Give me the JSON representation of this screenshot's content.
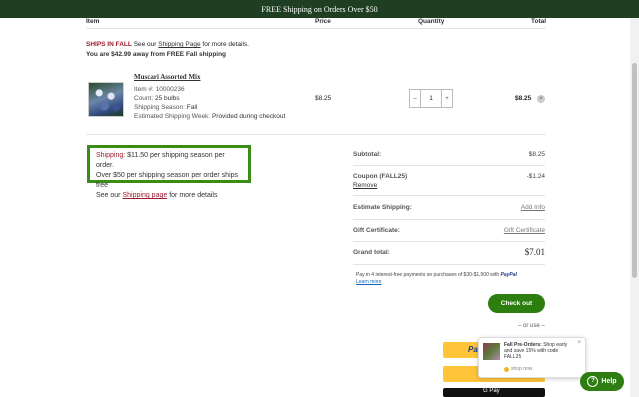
{
  "banner": {
    "text": "FREE Shipping on Orders Over $50"
  },
  "table_headers": {
    "item": "Item",
    "price": "Price",
    "quantity": "Quantity",
    "total": "Total"
  },
  "notice": {
    "ships_in": "SHIPS IN FALL",
    "see_our": "See our",
    "shipping_page_link": "Shipping Page",
    "more_details": "for more details.",
    "free_shipping_msg": "You are $42.99 away from FREE Fall shipping"
  },
  "cart_item": {
    "name": "Muscari Assorted Mix",
    "item_label": "Item #:",
    "item_number": "10000236",
    "count_label": "Count:",
    "count": "25 bulbs",
    "season_label": "Shipping Season:",
    "season": "Fall",
    "est_label": "Estimated Shipping Week:",
    "est": "Provided during checkout",
    "price": "$8.25",
    "quantity": "1",
    "total": "$8.25"
  },
  "shipping_box": {
    "label": "Shipping:",
    "line1": "$11.50 per shipping season per order.",
    "line2": "Over $50 per shipping season per order ships free",
    "line3_pre": "See our",
    "line3_link": "Shipping page",
    "line3_post": "for more details"
  },
  "summary": {
    "subtotal_label": "Subtotal:",
    "subtotal": "$8.25",
    "coupon_label": "Coupon (FALL25)",
    "coupon_value": "-$1.24",
    "remove": "Remove",
    "estimate_label": "Estimate Shipping:",
    "estimate_link": "Add Info",
    "gift_label": "Gift Certificate:",
    "gift_link": "Gift Certificate",
    "grand_label": "Grand total:",
    "grand": "$7.01"
  },
  "paypal_note": {
    "text": "Pay in 4 interest-free payments on purchases of $30-$1,500 with",
    "brand": "PayPal",
    "learn": "Learn more"
  },
  "checkout_label": "Check out",
  "or_use": "– or use –",
  "toast": {
    "title": "Fall Pre-Orders:",
    "body": "Shop early and save 15% with code FALL25",
    "cta": "shop now"
  },
  "help_label": "Help",
  "colors": {
    "banner": "#1e3f22",
    "accent_green": "#2e7d10",
    "red": "#9b1b2f",
    "paypal_yellow": "#ffc439"
  }
}
